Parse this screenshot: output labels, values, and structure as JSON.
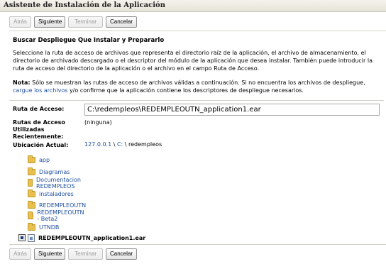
{
  "window": {
    "title": "Asistente de Instalación de la Aplicación"
  },
  "buttons": {
    "back": "Atrás",
    "next": "Siguiente",
    "finish": "Terminar",
    "cancel": "Cancelar"
  },
  "content": {
    "heading": "Buscar Despliegue Que Instalar y Prepararlo",
    "description": "Seleccione la ruta de acceso de archivos que representa el directorio raíz de la aplicación, el archivo de almacenamiento, el directorio de archivado descargado o el descriptor del módulo de la aplicación que desea instalar. También puede introducir la ruta de acceso del directorio de la aplicación o el archivo en el campo Ruta de Acceso.",
    "note_label": "Nota:",
    "note_text_1": " Sólo se muestran las rutas de acceso de archivos válidas a continuación. Si no encuentra los archivos de despliegue, ",
    "note_link": "cargue los archivos",
    "note_text_2": " y/o confirme que la aplicación contiene los descriptores de despliegue necesarios."
  },
  "form": {
    "path_label": "Ruta de Acceso:",
    "path_value": "C:\\redempleos\\REDEMPLEOUTN_application1.ear",
    "recent_label": "Rutas de Acceso Utilizadas Recientemente:",
    "recent_value": "(ninguna)",
    "location_label": "Ubicación Actual:",
    "location_host": "127.0.0.1",
    "location_sep": " \\ ",
    "location_drive": "C:",
    "location_folder": " \\ redempleos"
  },
  "tree": {
    "folders": [
      "app",
      "Diagramas",
      "Documentacion REDEMPLEOS",
      "instaladores",
      "REDEMPLEOUTN",
      "REDEMPLEOUTN - Beta2",
      "UTNDB"
    ],
    "file": "REDEMPLEOUTN_application1.ear"
  }
}
